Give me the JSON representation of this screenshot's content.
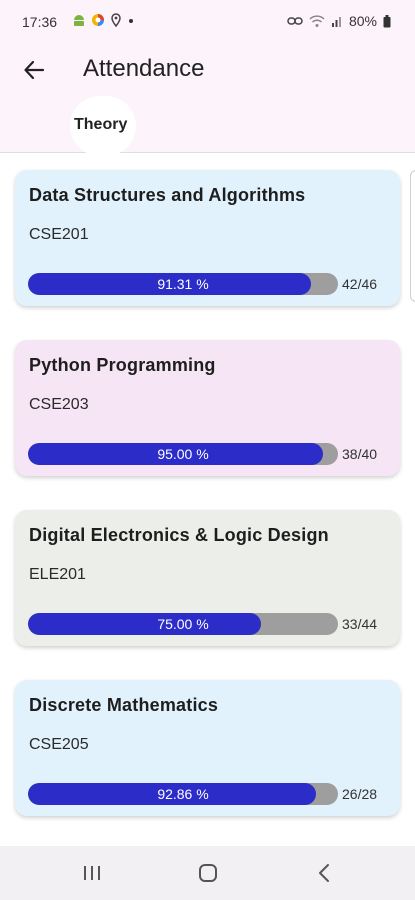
{
  "status": {
    "time": "17:36",
    "battery": "80%"
  },
  "header": {
    "title": "Attendance"
  },
  "tabs": [
    {
      "label": "Theory",
      "active": true
    }
  ],
  "colors": {
    "header_bg": "#fdf3fa",
    "bar_fill": "#2c2cc8",
    "bar_track": "#9e9e9e"
  },
  "courses": [
    {
      "name": "Data Structures and Algorithms",
      "code": "CSE201",
      "percent_label": "91.31 %",
      "percent": 91.31,
      "count": "42/46",
      "card_color": "#e1f2fc"
    },
    {
      "name": "Python Programming",
      "code": "CSE203",
      "percent_label": "95.00 %",
      "percent": 95.0,
      "count": "38/40",
      "card_color": "#f6e5f4"
    },
    {
      "name": "Digital Electronics & Logic Design",
      "code": "ELE201",
      "percent_label": "75.00 %",
      "percent": 75.0,
      "count": "33/44",
      "card_color": "#eceeea"
    },
    {
      "name": "Discrete Mathematics",
      "code": "CSE205",
      "percent_label": "92.86 %",
      "percent": 92.86,
      "count": "26/28",
      "card_color": "#e1f2fc"
    }
  ]
}
